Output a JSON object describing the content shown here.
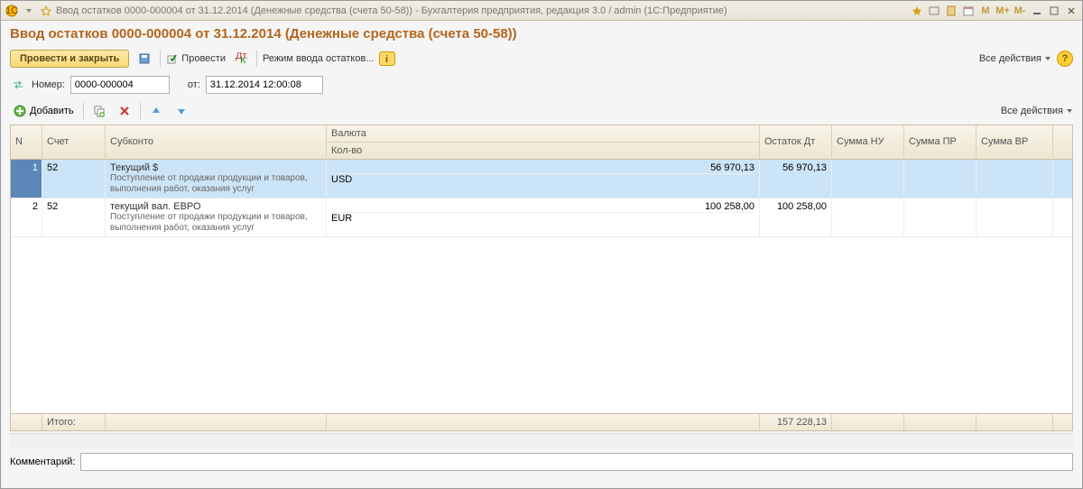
{
  "window": {
    "title": "Ввод остатков 0000-000004 от 31.12.2014 (Денежные средства (счета 50-58)) - Бухгалтерия предприятия, редакция 3.0 / admin  (1С:Предприятие)"
  },
  "page": {
    "title": "Ввод остатков 0000-000004 от 31.12.2014 (Денежные средства (счета 50-58))"
  },
  "toolbar": {
    "post_close": "Провести и закрыть",
    "post": "Провести",
    "mode": "Режим ввода остатков...",
    "all_actions": "Все действия"
  },
  "fields": {
    "number_label": "Номер:",
    "number_value": "0000-000004",
    "date_label": "от:",
    "date_value": "31.12.2014 12:00:08"
  },
  "subtoolbar": {
    "add": "Добавить",
    "all_actions": "Все действия"
  },
  "table": {
    "headers": {
      "n": "N",
      "account": "Счет",
      "subconto": "Субконто",
      "currency": "Валюта",
      "qty": "Кол-во",
      "balance_dt": "Остаток Дт",
      "sum_nu": "Сумма НУ",
      "sum_pr": "Сумма ПР",
      "sum_vr": "Сумма ВР"
    },
    "rows": [
      {
        "n": "1",
        "account": "52",
        "subconto1": "Текущий $",
        "subconto2": "Поступление от продажи продукции и товаров, выполнения работ, оказания услуг",
        "currency": "USD",
        "amount": "56 970,13",
        "balance_dt": "56 970,13",
        "selected": true
      },
      {
        "n": "2",
        "account": "52",
        "subconto1": "текущий вал. ЕВРО",
        "subconto2": "Поступление от продажи продукции и товаров, выполнения работ, оказания услуг",
        "currency": "EUR",
        "amount": "100 258,00",
        "balance_dt": "100 258,00",
        "selected": false
      }
    ],
    "footer": {
      "total_label": "Итого:",
      "total_balance_dt": "157 228,13"
    }
  },
  "comment": {
    "label": "Комментарий:",
    "value": ""
  }
}
